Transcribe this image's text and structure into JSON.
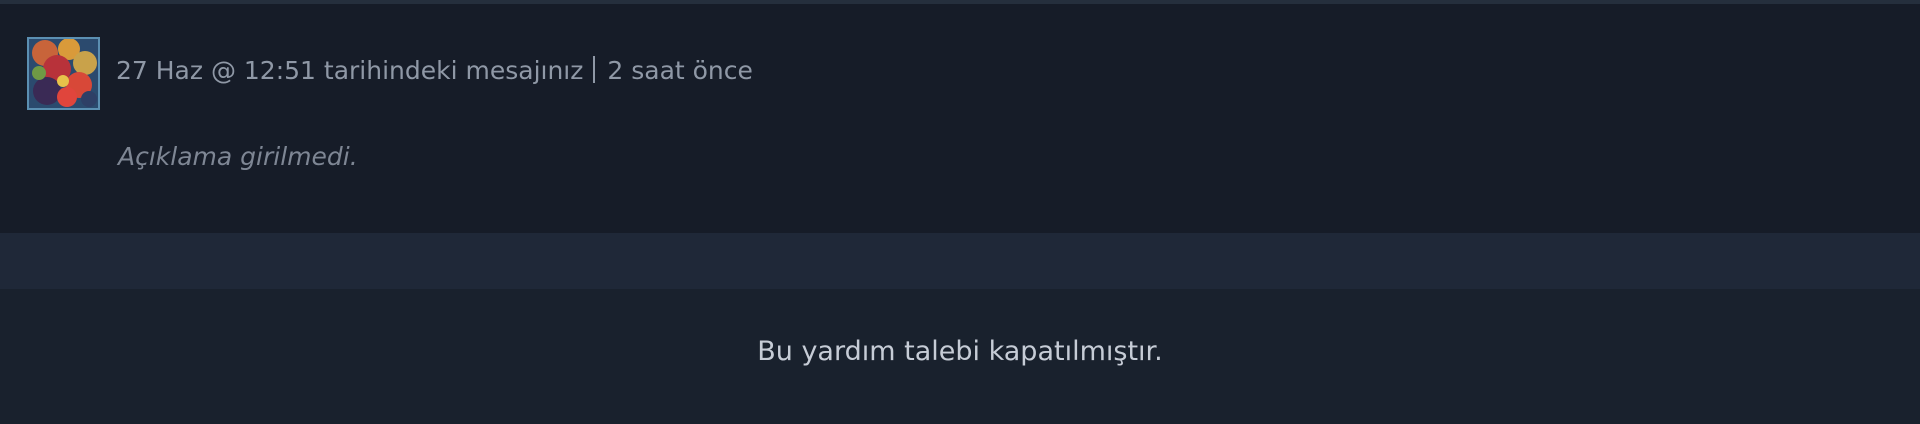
{
  "message": {
    "date_text": "27 Haz @ 12:51 tarihindeki mesajınız",
    "relative_time": "2 saat önce",
    "description": "Açıklama girilmedi."
  },
  "status": {
    "closed_text": "Bu yardım talebi kapatılmıştır."
  },
  "colors": {
    "background": "#171d28",
    "card_background": "#161c28",
    "divider_band": "#1f2838",
    "meta_text": "#8f98a6",
    "closed_text": "#c6ccd6",
    "avatar_border": "#5b8fb2"
  }
}
